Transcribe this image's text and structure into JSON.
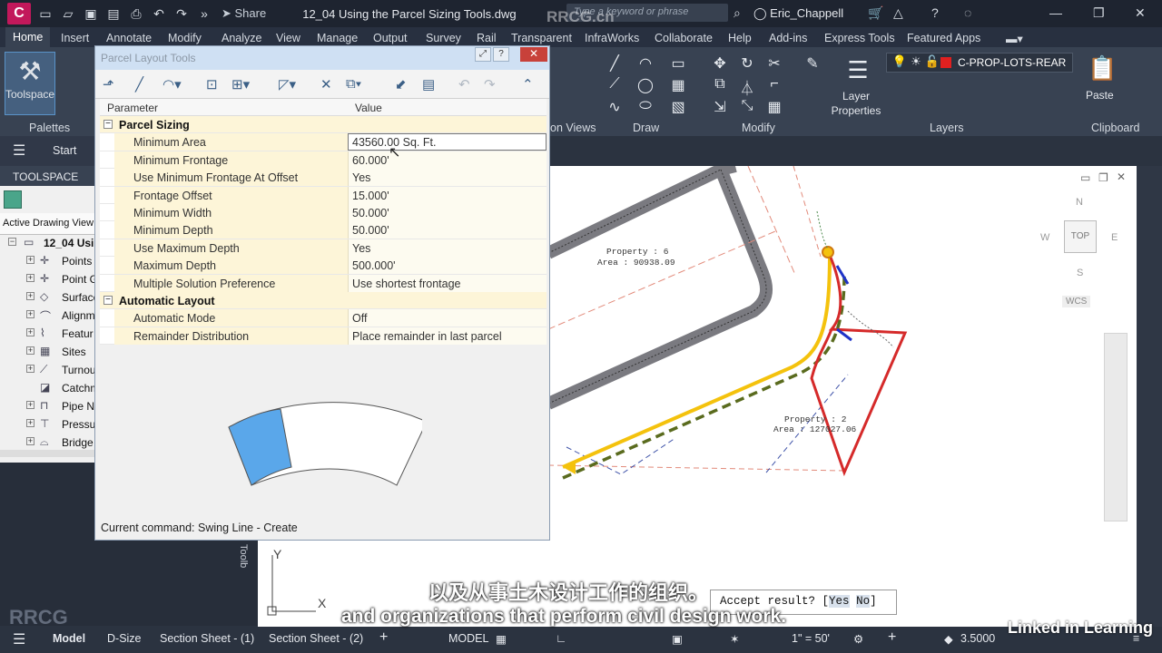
{
  "titlebar": {
    "app_letter": "C",
    "share": "Share",
    "document": "12_04 Using the Parcel Sizing Tools.dwg",
    "search_placeholder": "Type a keyword or phrase",
    "user": "Eric_Chappell"
  },
  "ribbon_tabs": [
    "Home",
    "Insert",
    "Annotate",
    "Modify",
    "Analyze",
    "View",
    "Manage",
    "Output",
    "Survey",
    "Rail",
    "Transparent",
    "InfraWorks",
    "Collaborate",
    "Help",
    "Add-ins",
    "Express Tools",
    "Featured Apps"
  ],
  "ribbon": {
    "toolspace": "Toolspace",
    "palettes": "Palettes",
    "views": "on Views",
    "draw": "Draw",
    "modify": "Modify",
    "layers": "Layers",
    "layer_properties": "Layer Properties",
    "current_layer": "C-PROP-LOTS-REAR",
    "layer_color": "#e02020",
    "paste": "Paste",
    "clipboard": "Clipboard"
  },
  "start_tab": "Start",
  "toolspace": {
    "header": "TOOLSPACE",
    "tab": "Active Drawing View",
    "root": "12_04 Usi",
    "items": [
      "Points",
      "Point G",
      "Surface",
      "Alignm",
      "Featur",
      "Sites",
      "Turnou",
      "Catchm",
      "Pipe N",
      "Pressu",
      "Bridge"
    ]
  },
  "dialog": {
    "title": "Parcel Layout Tools",
    "columns": [
      "Parameter",
      "Value"
    ],
    "rows": [
      {
        "type": "cat",
        "p": "Parcel Sizing",
        "v": ""
      },
      {
        "type": "row",
        "p": "Minimum Area",
        "v": "43560.00 Sq. Ft.",
        "selected": true
      },
      {
        "type": "row",
        "p": "Minimum Frontage",
        "v": "60.000'"
      },
      {
        "type": "row",
        "p": "Use Minimum Frontage At Offset",
        "v": "Yes"
      },
      {
        "type": "row",
        "p": "Frontage Offset",
        "v": "15.000'"
      },
      {
        "type": "row",
        "p": "Minimum Width",
        "v": "50.000'"
      },
      {
        "type": "row",
        "p": "Minimum Depth",
        "v": "50.000'"
      },
      {
        "type": "row",
        "p": "Use Maximum Depth",
        "v": "Yes"
      },
      {
        "type": "row",
        "p": "Maximum Depth",
        "v": "500.000'"
      },
      {
        "type": "row",
        "p": "Multiple Solution Preference",
        "v": "Use shortest frontage"
      },
      {
        "type": "cat",
        "p": "Automatic Layout",
        "v": ""
      },
      {
        "type": "row",
        "p": "Automatic Mode",
        "v": "Off"
      },
      {
        "type": "row",
        "p": "Remainder Distribution",
        "v": "Place remainder in last parcel"
      }
    ],
    "current_command": "Current command: Swing Line - Create"
  },
  "drawing": {
    "property6": "Property : 6",
    "area6": "Area : 90938.09",
    "property2": "Property : 2",
    "area2": "Area : 127027.06",
    "viewcube_top": "TOP",
    "compass": [
      "N",
      "W",
      "E",
      "S"
    ],
    "wcs": "WCS"
  },
  "command_line": {
    "prompt": "Accept result? [",
    "yes": "Yes",
    "no": "No",
    "close": "]"
  },
  "statusbar": {
    "tabs": [
      "Model",
      "D-Size",
      "Section Sheet - (1)",
      "Section Sheet - (2)"
    ],
    "model": "MODEL",
    "scale": "1\" = 50'",
    "value": "3.5000"
  },
  "subtitles": {
    "cn": "以及从事土木设计工作的组织。",
    "en": "and organizations that perform civil design work."
  },
  "watermarks": {
    "top": "RRCG.cn",
    "linkedin": "Linked in Learning",
    "bottom_left": "RRCG"
  }
}
